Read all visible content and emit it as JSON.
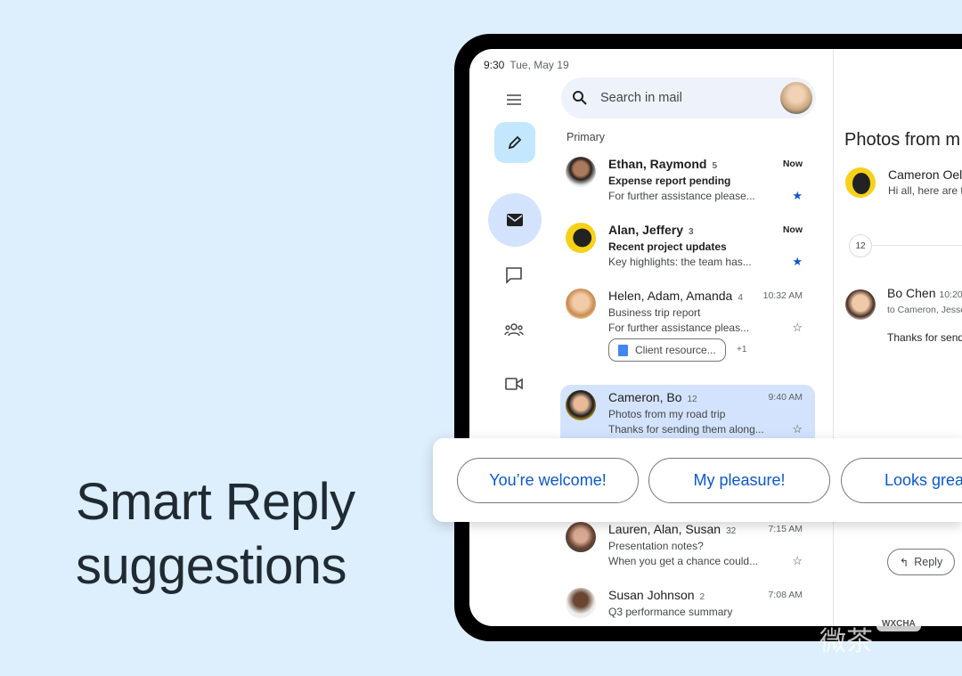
{
  "headline": [
    "Smart Reply",
    "suggestions"
  ],
  "status": {
    "time": "9:30",
    "date": "Tue, May 19"
  },
  "search": {
    "placeholder": "Search in mail"
  },
  "section": "Primary",
  "emails": [
    {
      "sender": "Ethan, Raymond",
      "count": "5",
      "time": "Now",
      "subject": "Expense report pending",
      "snippet": "For further assistance please...",
      "starred": true,
      "unread": true
    },
    {
      "sender": "Alan, Jeffery",
      "count": "3",
      "time": "Now",
      "subject": "Recent project updates",
      "snippet": "Key highlights: the team has...",
      "starred": true,
      "unread": true
    },
    {
      "sender": "Helen, Adam, Amanda",
      "count": "4",
      "time": "10:32 AM",
      "subject": "Business trip report",
      "snippet": "For further assistance pleas...",
      "starred": false,
      "attachment": "Client resource...",
      "attachment_more": "+1"
    },
    {
      "sender": "Cameron, Bo",
      "count": "12",
      "time": "9:40 AM",
      "subject": "Photos from my road trip",
      "snippet": "Thanks for sending them along...",
      "starred": false,
      "selected": true
    },
    {
      "sender": "Lauren, Alan, Susan",
      "count": "32",
      "time": "7:15 AM",
      "subject": "Presentation notes?",
      "snippet": "When you get a chance could...",
      "starred": false
    },
    {
      "sender": "Susan Johnson",
      "count": "2",
      "time": "7:08 AM",
      "subject": "Q3 performance summary",
      "snippet": ""
    }
  ],
  "reading": {
    "title": "Photos from m",
    "msg1_sender": "Cameron Oel",
    "msg1_snippet": "Hi all, here are t",
    "collapsed_count": "12",
    "msg2_sender": "Bo Chen",
    "msg2_time": "10:20",
    "msg2_to": "to Cameron, Jesse",
    "msg2_body": "Thanks for send",
    "reply": "Reply"
  },
  "smart_replies": [
    "You’re welcome!",
    "My pleasure!",
    "Looks grea"
  ],
  "watermark": {
    "text": "微茶",
    "badge": "WXCHA"
  },
  "colors": {
    "accent": "#0b57d0",
    "selected": "#d3e3fd",
    "compose": "#c2e7ff",
    "background": "#ddeefc"
  }
}
